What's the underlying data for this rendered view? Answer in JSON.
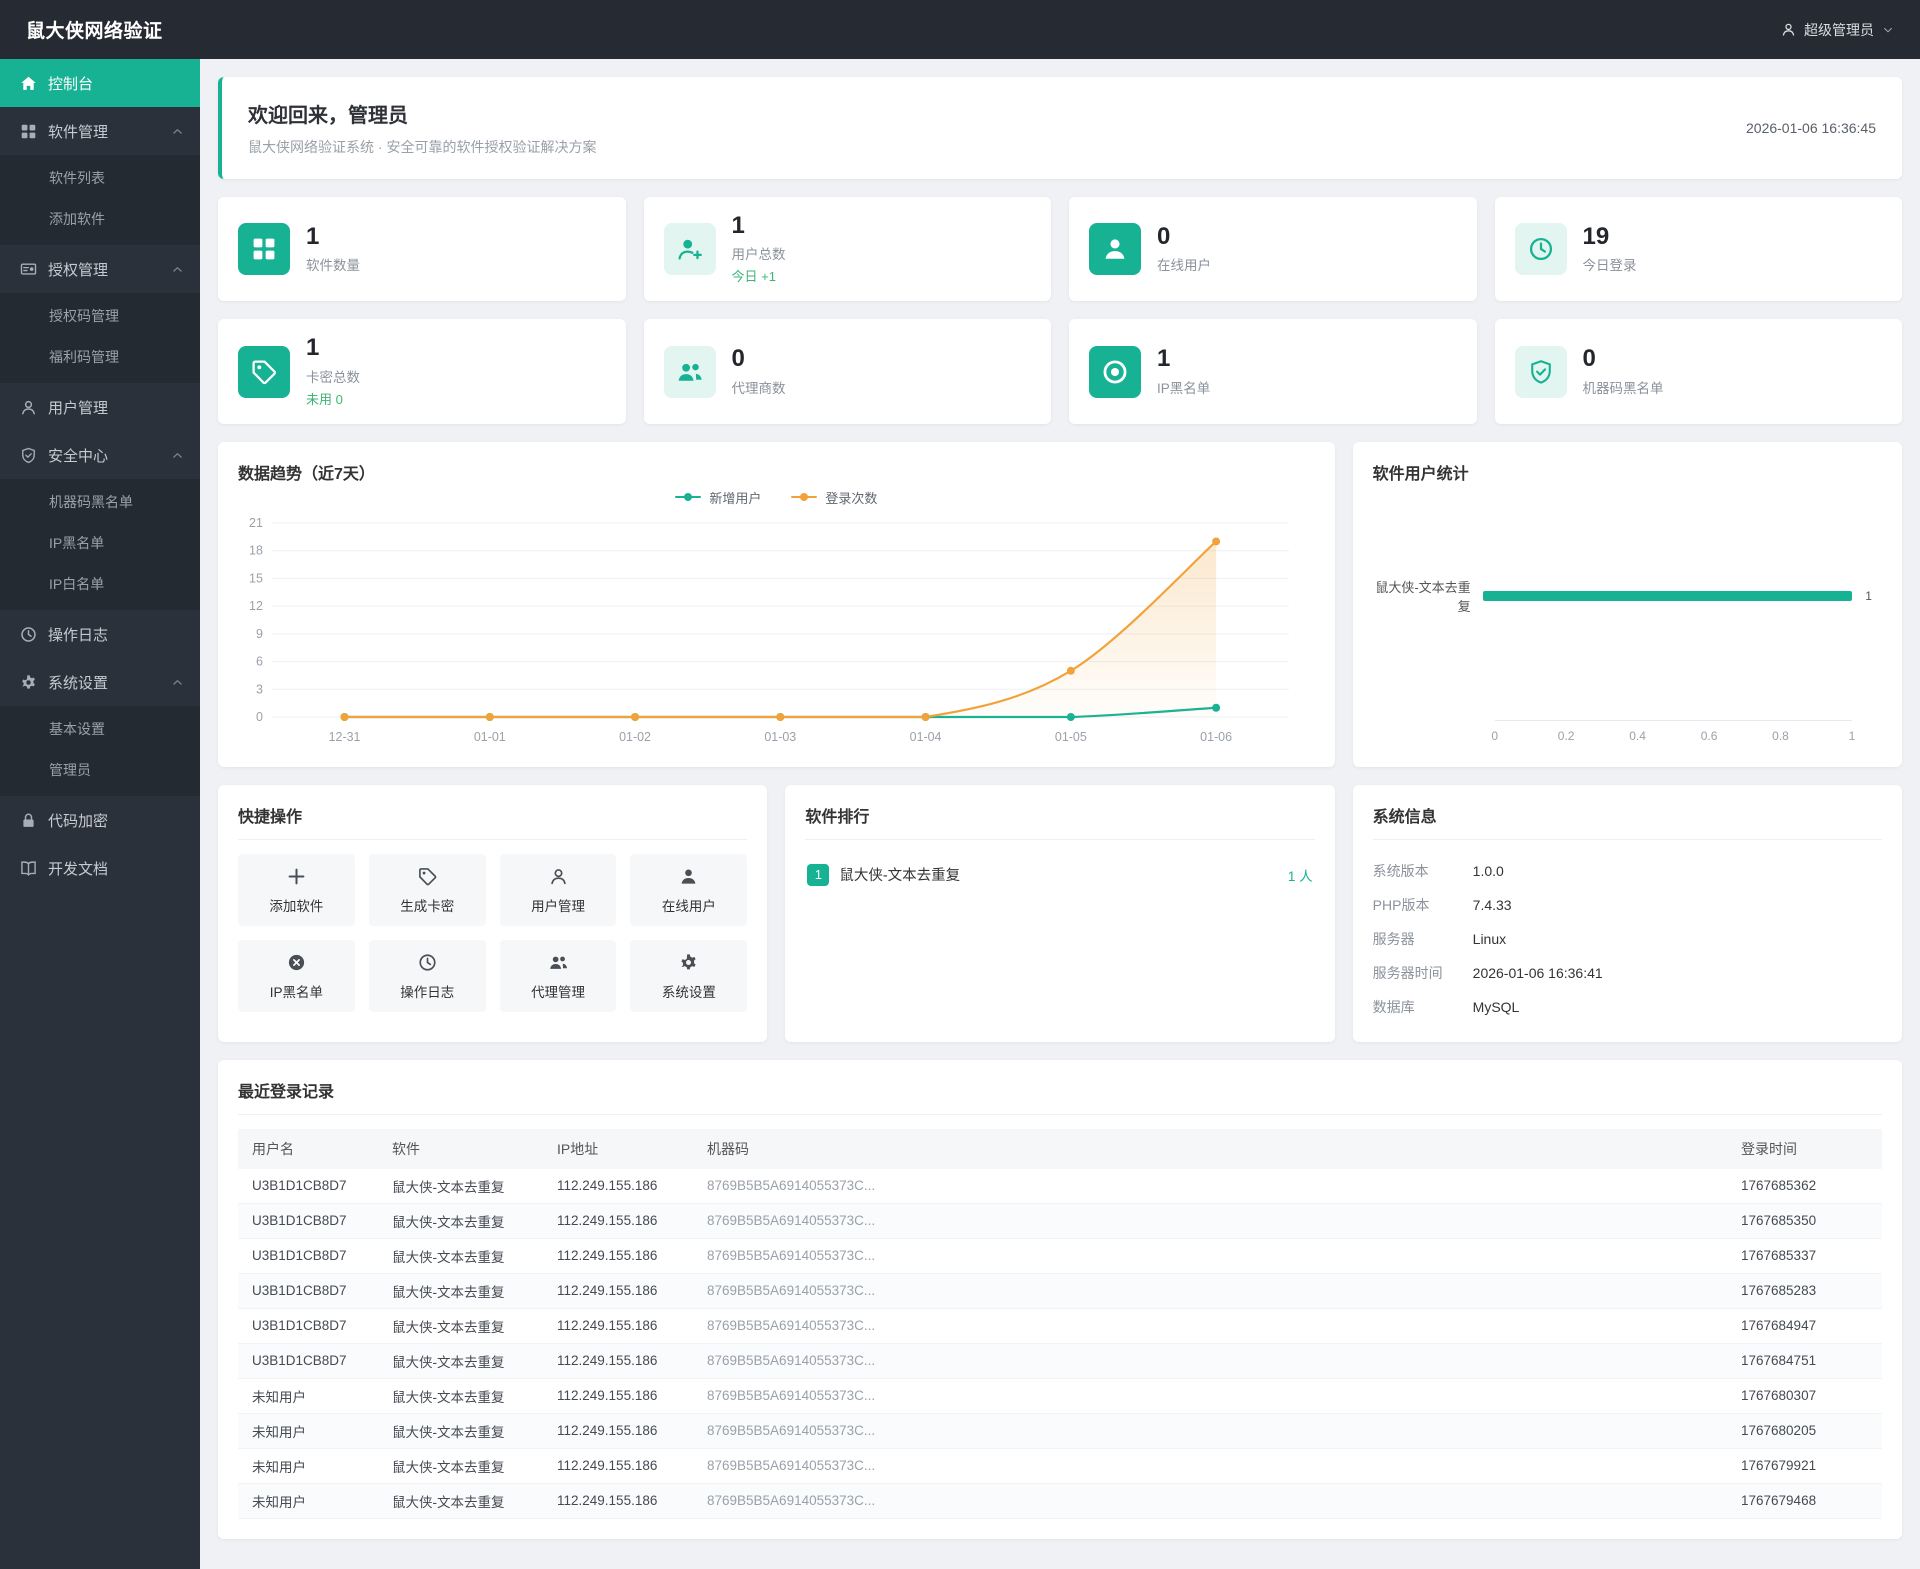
{
  "app": {
    "title": "鼠大侠网络验证",
    "admin_label": "超级管理员"
  },
  "colors": {
    "teal": "#17b294",
    "orange": "#f1a33a",
    "green": "#3eb575",
    "sidebar_dark": "#2b313a"
  },
  "welcome": {
    "title": "欢迎回来，管理员",
    "subtitle": "鼠大侠网络验证系统 · 安全可靠的软件授权验证解决方案",
    "timestamp": "2026-01-06 16:36:45"
  },
  "sidebar": {
    "items": [
      {
        "key": "dashboard",
        "label": "控制台",
        "icon": "dashboard-icon",
        "active": true
      },
      {
        "key": "software",
        "label": "软件管理",
        "icon": "apps-icon",
        "expanded": true,
        "children": [
          {
            "key": "software-list",
            "label": "软件列表"
          },
          {
            "key": "software-add",
            "label": "添加软件"
          }
        ]
      },
      {
        "key": "license",
        "label": "授权管理",
        "icon": "license-icon",
        "expanded": true,
        "children": [
          {
            "key": "license-codes",
            "label": "授权码管理"
          },
          {
            "key": "welfare-codes",
            "label": "福利码管理"
          }
        ]
      },
      {
        "key": "users",
        "label": "用户管理",
        "icon": "user-icon"
      },
      {
        "key": "security",
        "label": "安全中心",
        "icon": "shield-icon",
        "expanded": true,
        "children": [
          {
            "key": "device-blacklist",
            "label": "机器码黑名单"
          },
          {
            "key": "ip-blacklist",
            "label": "IP黑名单"
          },
          {
            "key": "ip-whitelist",
            "label": "IP白名单"
          }
        ]
      },
      {
        "key": "logs",
        "label": "操作日志",
        "icon": "clock-icon"
      },
      {
        "key": "settings",
        "label": "系统设置",
        "icon": "gear-icon",
        "expanded": true,
        "children": [
          {
            "key": "basic-settings",
            "label": "基本设置"
          },
          {
            "key": "admins",
            "label": "管理员"
          }
        ]
      },
      {
        "key": "encrypt",
        "label": "代码加密",
        "icon": "lock-icon"
      },
      {
        "key": "docs",
        "label": "开发文档",
        "icon": "book-icon"
      }
    ]
  },
  "stats": [
    {
      "key": "software-count",
      "value": "1",
      "label": "软件数量",
      "icon": "apps-icon",
      "tile": "solid"
    },
    {
      "key": "user-total",
      "value": "1",
      "label": "用户总数",
      "sub": "今日 +1",
      "icon": "user-add-icon",
      "tile": "light"
    },
    {
      "key": "online-users",
      "value": "0",
      "label": "在线用户",
      "icon": "person-icon",
      "tile": "solid"
    },
    {
      "key": "today-logins",
      "value": "19",
      "label": "今日登录",
      "icon": "clock-icon",
      "tile": "light"
    },
    {
      "key": "card-total",
      "value": "1",
      "label": "卡密总数",
      "sub": "未用 0",
      "icon": "tag-icon",
      "tile": "solid"
    },
    {
      "key": "agent-count",
      "value": "0",
      "label": "代理商数",
      "icon": "users-icon",
      "tile": "light"
    },
    {
      "key": "ip-blacklist",
      "value": "1",
      "label": "IP黑名单",
      "icon": "target-icon",
      "tile": "solid"
    },
    {
      "key": "device-blacklist",
      "value": "0",
      "label": "机器码黑名单",
      "icon": "shield-check-icon",
      "tile": "light"
    }
  ],
  "chart_data": [
    {
      "type": "line",
      "title": "数据趋势（近7天）",
      "categories": [
        "12-31",
        "01-01",
        "01-02",
        "01-03",
        "01-04",
        "01-05",
        "01-06"
      ],
      "series": [
        {
          "name": "新增用户",
          "color": "#17b294",
          "values": [
            0,
            0,
            0,
            0,
            0,
            0,
            1
          ],
          "area": false
        },
        {
          "name": "登录次数",
          "color": "#f1a33a",
          "values": [
            0,
            0,
            0,
            0,
            0,
            5,
            19
          ],
          "area": true
        }
      ],
      "ylim": [
        0,
        21
      ],
      "yticks": [
        0,
        3,
        6,
        9,
        12,
        15,
        18,
        21
      ],
      "grid": true,
      "legend_position": "top"
    },
    {
      "type": "bar",
      "orientation": "horizontal",
      "title": "软件用户统计",
      "categories": [
        "鼠大侠-文本去重复"
      ],
      "values": [
        1
      ],
      "xlim": [
        0,
        1
      ],
      "xticks": [
        0,
        0.2,
        0.4,
        0.6,
        0.8,
        1
      ],
      "bar_color": "#17b294"
    }
  ],
  "quick_actions": {
    "title": "快捷操作",
    "items": [
      {
        "key": "add-software",
        "label": "添加软件",
        "icon": "plus-icon"
      },
      {
        "key": "gen-card",
        "label": "生成卡密",
        "icon": "tag-icon"
      },
      {
        "key": "user-manage",
        "label": "用户管理",
        "icon": "user-icon"
      },
      {
        "key": "online-users",
        "label": "在线用户",
        "icon": "person-icon"
      },
      {
        "key": "ip-blacklist",
        "label": "IP黑名单",
        "icon": "x-circle-icon"
      },
      {
        "key": "op-logs",
        "label": "操作日志",
        "icon": "clock-icon"
      },
      {
        "key": "agent-manage",
        "label": "代理管理",
        "icon": "users-icon"
      },
      {
        "key": "system-settings",
        "label": "系统设置",
        "icon": "gear-icon"
      }
    ]
  },
  "ranking": {
    "title": "软件排行",
    "items": [
      {
        "rank": "1",
        "name": "鼠大侠-文本去重复",
        "count": "1 人"
      }
    ]
  },
  "system_info": {
    "title": "系统信息",
    "rows": [
      {
        "label": "系统版本",
        "value": "1.0.0"
      },
      {
        "label": "PHP版本",
        "value": "7.4.33"
      },
      {
        "label": "服务器",
        "value": "Linux"
      },
      {
        "label": "服务器时间",
        "value": "2026-01-06 16:36:41"
      },
      {
        "label": "数据库",
        "value": "MySQL"
      }
    ]
  },
  "recent_logins": {
    "title": "最近登录记录",
    "columns": [
      "用户名",
      "软件",
      "IP地址",
      "机器码",
      "登录时间"
    ],
    "rows": [
      [
        "U3B1D1CB8D7",
        "鼠大侠-文本去重复",
        "112.249.155.186",
        "8769B5B5A6914055373C...",
        "1767685362"
      ],
      [
        "U3B1D1CB8D7",
        "鼠大侠-文本去重复",
        "112.249.155.186",
        "8769B5B5A6914055373C...",
        "1767685350"
      ],
      [
        "U3B1D1CB8D7",
        "鼠大侠-文本去重复",
        "112.249.155.186",
        "8769B5B5A6914055373C...",
        "1767685337"
      ],
      [
        "U3B1D1CB8D7",
        "鼠大侠-文本去重复",
        "112.249.155.186",
        "8769B5B5A6914055373C...",
        "1767685283"
      ],
      [
        "U3B1D1CB8D7",
        "鼠大侠-文本去重复",
        "112.249.155.186",
        "8769B5B5A6914055373C...",
        "1767684947"
      ],
      [
        "U3B1D1CB8D7",
        "鼠大侠-文本去重复",
        "112.249.155.186",
        "8769B5B5A6914055373C...",
        "1767684751"
      ],
      [
        "未知用户",
        "鼠大侠-文本去重复",
        "112.249.155.186",
        "8769B5B5A6914055373C...",
        "1767680307"
      ],
      [
        "未知用户",
        "鼠大侠-文本去重复",
        "112.249.155.186",
        "8769B5B5A6914055373C...",
        "1767680205"
      ],
      [
        "未知用户",
        "鼠大侠-文本去重复",
        "112.249.155.186",
        "8769B5B5A6914055373C...",
        "1767679921"
      ],
      [
        "未知用户",
        "鼠大侠-文本去重复",
        "112.249.155.186",
        "8769B5B5A6914055373C...",
        "1767679468"
      ]
    ]
  }
}
